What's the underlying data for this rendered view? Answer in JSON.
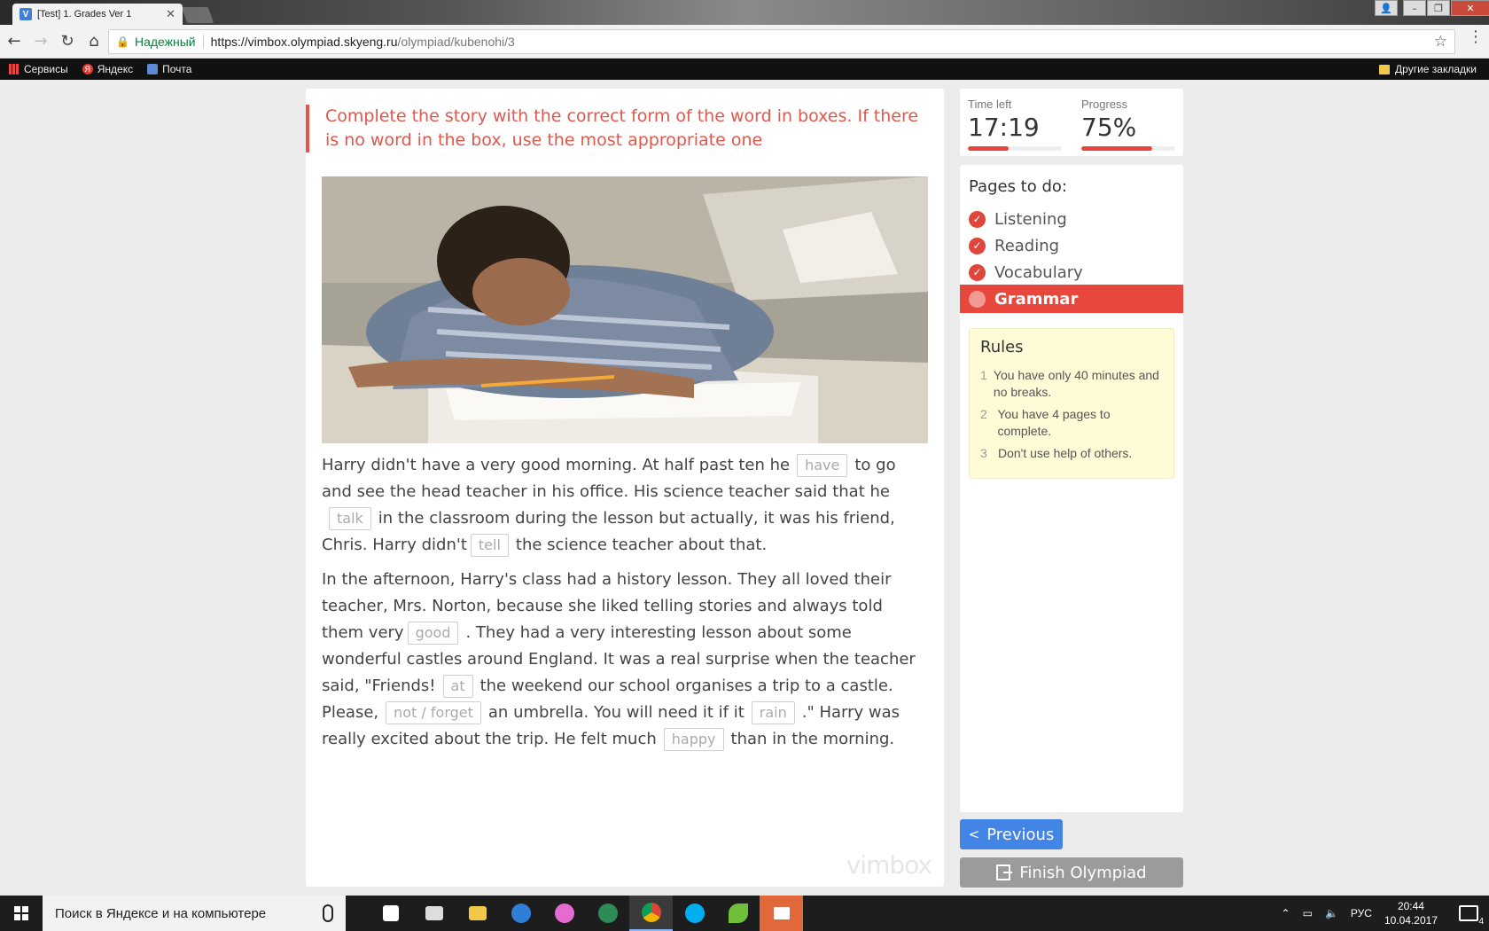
{
  "browser": {
    "tab_title": "[Test] 1. Grades Ver 1",
    "tab_favicon": "V",
    "secure_label": "Надежный",
    "url_host": "https://vimbox.olympiad.skyeng.ru",
    "url_path": "/olympiad/kubenohi/3",
    "bookmarks": [
      "Сервисы",
      "Яндекс",
      "Почта"
    ],
    "other_bookmarks": "Другие закладки"
  },
  "task": {
    "instruction": "Complete the story with the correct form of the word in boxes. If there is no word in the box, use the most appropriate one",
    "image_alt": "boy-asleep-on-desk",
    "paragraph1": {
      "t1": "Harry didn't have a very good morning. At half past ten he",
      "g1": "have",
      "t2": "to go and see the head teacher in his office. His science teacher said that he",
      "g2": "talk",
      "t3": "in the classroom during the lesson but actually, it was his friend, Chris. Harry didn't",
      "g3": "tell",
      "t4": "the science teacher about that."
    },
    "paragraph2": {
      "t1": "In the afternoon, Harry's class had a history lesson. They all loved their teacher, Mrs. Norton, because she liked telling stories and always told them very",
      "g1": "good",
      "t2": ". They had a very interesting lesson about some wonderful castles around England. It was a real surprise when the teacher said, \"Friends!",
      "g2": "at",
      "t3": "the weekend our school organises a trip to a castle. Please,",
      "g3": "not / forget",
      "t4": "an umbrella. You will need it if it",
      "g4": "rain",
      "t5": ".\" Harry was really excited about the trip. He felt much",
      "g5": "happy",
      "t6": "than in the morning."
    },
    "watermark": "vimbox"
  },
  "stats": {
    "time_label": "Time left",
    "time_value": "17:19",
    "time_fraction": 0.43,
    "progress_label": "Progress",
    "progress_value": "75%",
    "progress_fraction": 0.75
  },
  "pages": {
    "title": "Pages to do:",
    "items": [
      {
        "label": "Listening",
        "done": true
      },
      {
        "label": "Reading",
        "done": true
      },
      {
        "label": "Vocabulary",
        "done": true
      },
      {
        "label": "Grammar",
        "done": false,
        "active": true
      }
    ]
  },
  "rules": {
    "title": "Rules",
    "items": [
      {
        "num": "1",
        "text": "You have only 40 minutes and no breaks."
      },
      {
        "num": "2",
        "text": "You have 4 pages to complete."
      },
      {
        "num": "3",
        "text": "Don't use help of others."
      }
    ]
  },
  "buttons": {
    "previous": "Previous",
    "finish": "Finish Olympiad"
  },
  "taskbar": {
    "search_placeholder": "Поиск в Яндексе и на компьютере",
    "lang": "РУС",
    "time": "20:44",
    "date": "10.04.2017",
    "notifications": "4"
  },
  "colors": {
    "accent_red": "#e8473d",
    "primary_blue": "#4285e4",
    "disabled_gray": "#9b9b9b",
    "rules_bg": "#fffbd7"
  }
}
